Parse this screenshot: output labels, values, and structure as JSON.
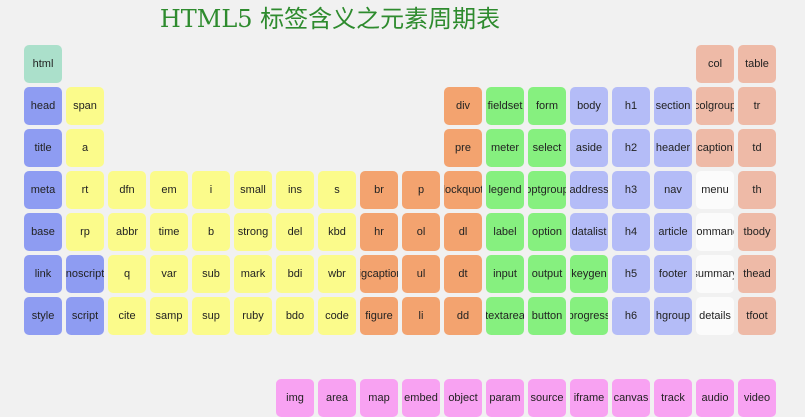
{
  "page": {
    "title": "HTML5 标签含义之元素周期表"
  },
  "colors": {
    "root": "#abe0cb",
    "metadata": "#8e9cf2",
    "text": "#fbfb8b",
    "grouping": "#f3a36f",
    "forms": "#86f07f",
    "sections": "#b4bcf7",
    "tables": "#eebaa7",
    "interactive": "#fbfbfb",
    "embedded": "#f8a2f2"
  },
  "rows": [
    [
      {
        "label": "html",
        "cat": "root",
        "col": 0
      },
      {
        "label": "col",
        "cat": "tables",
        "col": 16
      },
      {
        "label": "table",
        "cat": "tables",
        "col": 17
      }
    ],
    [
      {
        "label": "head",
        "cat": "meta",
        "col": 0
      },
      {
        "label": "span",
        "cat": "text",
        "col": 1
      },
      {
        "label": "div",
        "cat": "grouping",
        "col": 10
      },
      {
        "label": "fieldset",
        "cat": "forms",
        "col": 11
      },
      {
        "label": "form",
        "cat": "forms",
        "col": 12
      },
      {
        "label": "body",
        "cat": "section",
        "col": 13
      },
      {
        "label": "h1",
        "cat": "section",
        "col": 14
      },
      {
        "label": "section",
        "cat": "section",
        "col": 15
      },
      {
        "label": "colgroup",
        "cat": "tables",
        "col": 16
      },
      {
        "label": "tr",
        "cat": "tables",
        "col": 17
      }
    ],
    [
      {
        "label": "title",
        "cat": "meta",
        "col": 0
      },
      {
        "label": "a",
        "cat": "text",
        "col": 1
      },
      {
        "label": "pre",
        "cat": "grouping",
        "col": 10
      },
      {
        "label": "meter",
        "cat": "forms",
        "col": 11
      },
      {
        "label": "select",
        "cat": "forms",
        "col": 12
      },
      {
        "label": "aside",
        "cat": "section",
        "col": 13
      },
      {
        "label": "h2",
        "cat": "section",
        "col": 14
      },
      {
        "label": "header",
        "cat": "section",
        "col": 15
      },
      {
        "label": "caption",
        "cat": "tables",
        "col": 16
      },
      {
        "label": "td",
        "cat": "tables",
        "col": 17
      }
    ],
    [
      {
        "label": "meta",
        "cat": "meta",
        "col": 0
      },
      {
        "label": "rt",
        "cat": "text",
        "col": 1
      },
      {
        "label": "dfn",
        "cat": "text",
        "col": 2
      },
      {
        "label": "em",
        "cat": "text",
        "col": 3
      },
      {
        "label": "i",
        "cat": "text",
        "col": 4
      },
      {
        "label": "small",
        "cat": "text",
        "col": 5
      },
      {
        "label": "ins",
        "cat": "text",
        "col": 6
      },
      {
        "label": "s",
        "cat": "text",
        "col": 7
      },
      {
        "label": "br",
        "cat": "grouping",
        "col": 8
      },
      {
        "label": "p",
        "cat": "grouping",
        "col": 9
      },
      {
        "label": "blockquote",
        "cat": "grouping",
        "col": 10
      },
      {
        "label": "legend",
        "cat": "forms",
        "col": 11
      },
      {
        "label": "optgroup",
        "cat": "forms",
        "col": 12
      },
      {
        "label": "address",
        "cat": "section",
        "col": 13
      },
      {
        "label": "h3",
        "cat": "section",
        "col": 14
      },
      {
        "label": "nav",
        "cat": "section",
        "col": 15
      },
      {
        "label": "menu",
        "cat": "interact",
        "col": 16
      },
      {
        "label": "th",
        "cat": "tables",
        "col": 17
      }
    ],
    [
      {
        "label": "base",
        "cat": "meta",
        "col": 0
      },
      {
        "label": "rp",
        "cat": "text",
        "col": 1
      },
      {
        "label": "abbr",
        "cat": "text",
        "col": 2
      },
      {
        "label": "time",
        "cat": "text",
        "col": 3
      },
      {
        "label": "b",
        "cat": "text",
        "col": 4
      },
      {
        "label": "strong",
        "cat": "text",
        "col": 5
      },
      {
        "label": "del",
        "cat": "text",
        "col": 6
      },
      {
        "label": "kbd",
        "cat": "text",
        "col": 7
      },
      {
        "label": "hr",
        "cat": "grouping",
        "col": 8
      },
      {
        "label": "ol",
        "cat": "grouping",
        "col": 9
      },
      {
        "label": "dl",
        "cat": "grouping",
        "col": 10
      },
      {
        "label": "label",
        "cat": "forms",
        "col": 11
      },
      {
        "label": "option",
        "cat": "forms",
        "col": 12
      },
      {
        "label": "datalist",
        "cat": "section",
        "col": 13
      },
      {
        "label": "h4",
        "cat": "section",
        "col": 14
      },
      {
        "label": "article",
        "cat": "section",
        "col": 15
      },
      {
        "label": "command",
        "cat": "interact",
        "col": 16
      },
      {
        "label": "tbody",
        "cat": "tables",
        "col": 17
      }
    ],
    [
      {
        "label": "link",
        "cat": "meta",
        "col": 0
      },
      {
        "label": "noscript",
        "cat": "meta",
        "col": 1
      },
      {
        "label": "q",
        "cat": "text",
        "col": 2
      },
      {
        "label": "var",
        "cat": "text",
        "col": 3
      },
      {
        "label": "sub",
        "cat": "text",
        "col": 4
      },
      {
        "label": "mark",
        "cat": "text",
        "col": 5
      },
      {
        "label": "bdi",
        "cat": "text",
        "col": 6
      },
      {
        "label": "wbr",
        "cat": "text",
        "col": 7
      },
      {
        "label": "figcaption",
        "cat": "grouping",
        "col": 8
      },
      {
        "label": "ul",
        "cat": "grouping",
        "col": 9
      },
      {
        "label": "dt",
        "cat": "grouping",
        "col": 10
      },
      {
        "label": "input",
        "cat": "forms",
        "col": 11
      },
      {
        "label": "output",
        "cat": "forms",
        "col": 12
      },
      {
        "label": "keygen",
        "cat": "forms",
        "col": 13
      },
      {
        "label": "h5",
        "cat": "section",
        "col": 14
      },
      {
        "label": "footer",
        "cat": "section",
        "col": 15
      },
      {
        "label": "summary",
        "cat": "interact",
        "col": 16
      },
      {
        "label": "thead",
        "cat": "tables",
        "col": 17
      }
    ],
    [
      {
        "label": "style",
        "cat": "meta",
        "col": 0
      },
      {
        "label": "script",
        "cat": "meta",
        "col": 1
      },
      {
        "label": "cite",
        "cat": "text",
        "col": 2
      },
      {
        "label": "samp",
        "cat": "text",
        "col": 3
      },
      {
        "label": "sup",
        "cat": "text",
        "col": 4
      },
      {
        "label": "ruby",
        "cat": "text",
        "col": 5
      },
      {
        "label": "bdo",
        "cat": "text",
        "col": 6
      },
      {
        "label": "code",
        "cat": "text",
        "col": 7
      },
      {
        "label": "figure",
        "cat": "grouping",
        "col": 8
      },
      {
        "label": "li",
        "cat": "grouping",
        "col": 9
      },
      {
        "label": "dd",
        "cat": "grouping",
        "col": 10
      },
      {
        "label": "textarea",
        "cat": "forms",
        "col": 11
      },
      {
        "label": "button",
        "cat": "forms",
        "col": 12
      },
      {
        "label": "progress",
        "cat": "forms",
        "col": 13
      },
      {
        "label": "h6",
        "cat": "section",
        "col": 14
      },
      {
        "label": "hgroup",
        "cat": "section",
        "col": 15
      },
      {
        "label": "details",
        "cat": "interact",
        "col": 16
      },
      {
        "label": "tfoot",
        "cat": "tables",
        "col": 17
      }
    ]
  ],
  "bottom_row": [
    {
      "label": "img",
      "cat": "embed",
      "col": 6
    },
    {
      "label": "area",
      "cat": "embed",
      "col": 7
    },
    {
      "label": "map",
      "cat": "embed",
      "col": 8
    },
    {
      "label": "embed",
      "cat": "embed",
      "col": 9
    },
    {
      "label": "object",
      "cat": "embed",
      "col": 10
    },
    {
      "label": "param",
      "cat": "embed",
      "col": 11
    },
    {
      "label": "source",
      "cat": "embed",
      "col": 12
    },
    {
      "label": "iframe",
      "cat": "embed",
      "col": 13
    },
    {
      "label": "canvas",
      "cat": "embed",
      "col": 14
    },
    {
      "label": "track",
      "cat": "embed",
      "col": 15
    },
    {
      "label": "audio",
      "cat": "embed",
      "col": 16
    },
    {
      "label": "video",
      "cat": "embed",
      "col": 17
    }
  ]
}
